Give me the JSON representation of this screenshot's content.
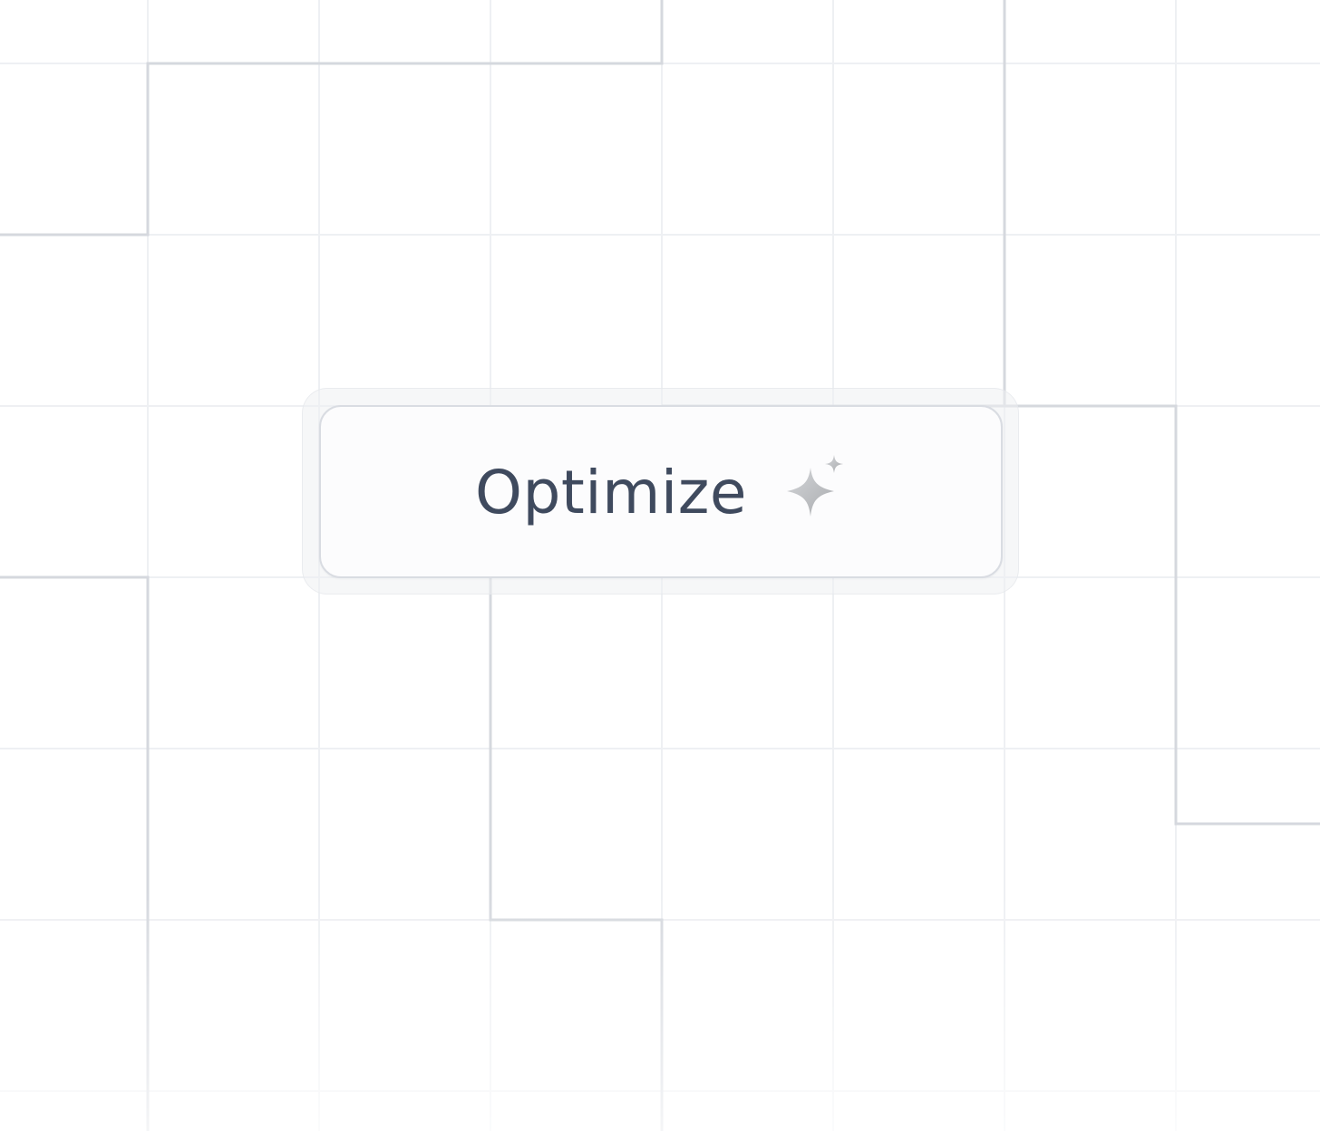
{
  "button": {
    "label": "Optimize",
    "icon": "sparkle-icon"
  },
  "colors": {
    "background": "#ffffff",
    "grid_faint": "#eef0f3",
    "grid_line": "#d5d8de",
    "button_border": "#d9dce2",
    "label_text": "#3f4a5e",
    "sparkle": "#b8babd"
  }
}
